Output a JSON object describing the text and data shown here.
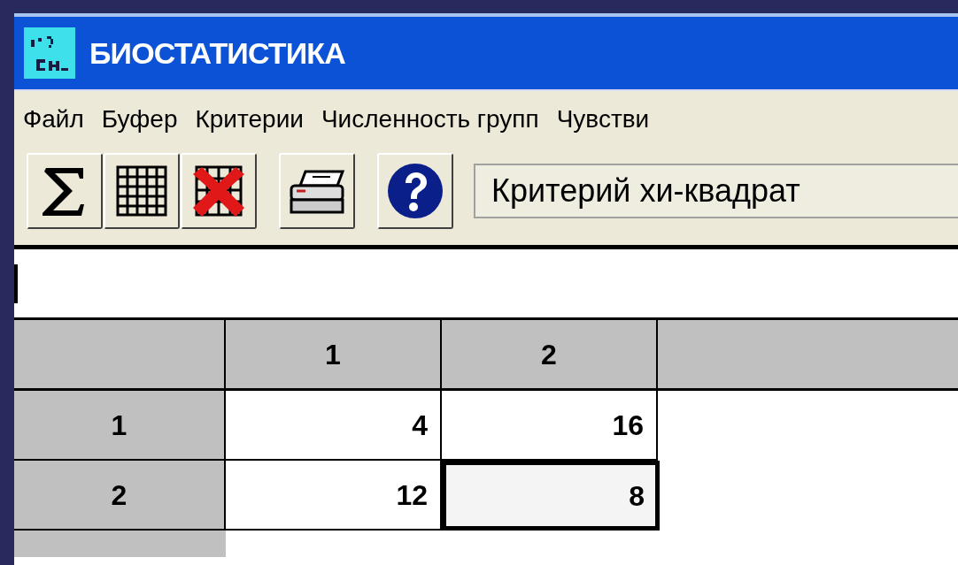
{
  "window": {
    "title": "БИОСТАТИСТИКА"
  },
  "menu": [
    "Файл",
    "Буфер",
    "Критерии",
    "Численность групп",
    "Чувстви"
  ],
  "toolbar": [
    {
      "kind": "sum"
    },
    {
      "kind": "grid"
    },
    {
      "kind": "clear-grid"
    },
    {
      "kind": "gap"
    },
    {
      "kind": "print"
    },
    {
      "kind": "gap"
    },
    {
      "kind": "help"
    }
  ],
  "criterion_select": {
    "value": "Критерий хи-квадрат"
  },
  "table": {
    "columns": [
      "1",
      "2"
    ],
    "rows": [
      {
        "header": "1",
        "cells": [
          {
            "value": "4",
            "selected": false
          },
          {
            "value": "16",
            "selected": false
          }
        ]
      },
      {
        "header": "2",
        "cells": [
          {
            "value": "12",
            "selected": false
          },
          {
            "value": "8",
            "selected": true
          }
        ]
      }
    ]
  }
}
